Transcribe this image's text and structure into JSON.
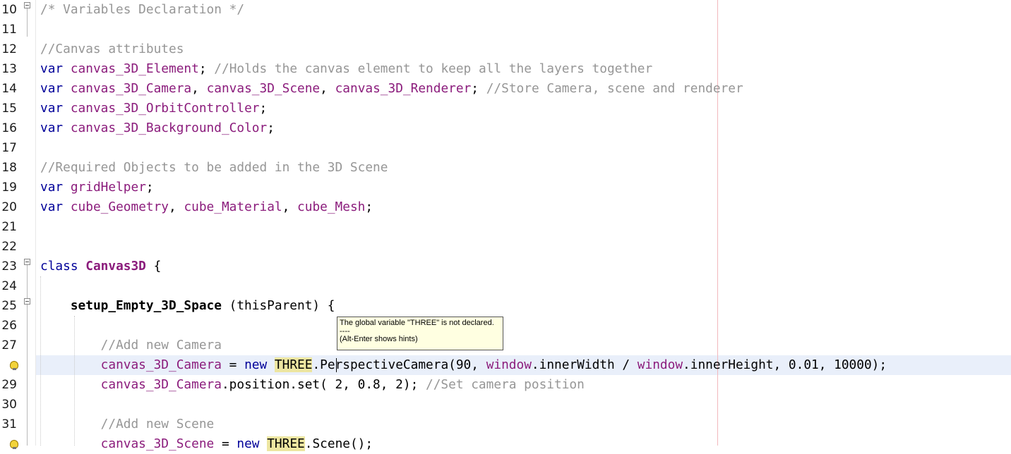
{
  "editor": {
    "line_numbers": [
      "10",
      "11",
      "12",
      "13",
      "14",
      "15",
      "16",
      "17",
      "18",
      "19",
      "20",
      "21",
      "22",
      "23",
      "24",
      "25",
      "26",
      "27",
      "28",
      "29",
      "30",
      "31",
      "32"
    ],
    "lines": {
      "l10": {
        "c1": "/* Variables Declaration */"
      },
      "l12": {
        "c1": "//Canvas attributes"
      },
      "l13": {
        "k1": "var",
        "v1": "canvas_3D_Element",
        "p1": ";",
        "c1": "//Holds the canvas element to keep all the layers together"
      },
      "l14": {
        "k1": "var",
        "v1": "canvas_3D_Camera",
        "p1": ", ",
        "v2": "canvas_3D_Scene",
        "p2": ", ",
        "v3": "canvas_3D_Renderer",
        "p3": ";",
        "c1": "//Store Camera, scene and renderer"
      },
      "l15": {
        "k1": "var",
        "v1": "canvas_3D_OrbitController",
        "p1": ";"
      },
      "l16": {
        "k1": "var",
        "v1": "canvas_3D_Background_Color",
        "p1": ";"
      },
      "l18": {
        "c1": "//Required Objects to be added in the 3D Scene"
      },
      "l19": {
        "k1": "var",
        "v1": "gridHelper",
        "p1": ";"
      },
      "l20": {
        "k1": "var",
        "v1": "cube_Geometry",
        "p1": ", ",
        "v2": "cube_Material",
        "p2": ", ",
        "v3": "cube_Mesh",
        "p3": ";"
      },
      "l23": {
        "k1": "class",
        "cls": "Canvas3D",
        "p1": " {"
      },
      "l25": {
        "fn": "setup_Empty_3D_Space",
        "p1": " (thisParent) {"
      },
      "l27": {
        "c1": "//Add new Camera"
      },
      "l28": {
        "v1": "canvas_3D_Camera",
        "p1": " = ",
        "k1": "new",
        "m1": "THREE",
        "p2": ".PerspectiveCamera(90, ",
        "v2": "window",
        "p3": ".innerWidth / ",
        "v3": "window",
        "p4": ".innerHeight, 0.01, 10000);"
      },
      "l29": {
        "v1": "canvas_3D_Camera",
        "p1": ".position.set( 2, 0.8, 2); ",
        "c1": "//Set camera position"
      },
      "l31": {
        "c1": "//Add new Scene"
      },
      "l32": {
        "v1": "canvas_3D_Scene",
        "p1": " = ",
        "k1": "new",
        "m1": "THREE",
        "p2": ".Scene();"
      }
    }
  },
  "tooltip": {
    "line1": "The global variable \"THREE\" is not declared.",
    "line2": "----",
    "line3": "(Alt-Enter shows hints)"
  },
  "icons": {
    "fold": "fold-collapse-icon",
    "hint": "lightbulb-warning-icon"
  },
  "colors": {
    "keyword": "#000099",
    "variable": "#8b1c7c",
    "comment": "#969696",
    "current_line": "#e9effa",
    "occurrence_mark": "#ede6a1",
    "right_margin": "#f2b8bd",
    "tooltip_bg": "#ffffe1"
  }
}
